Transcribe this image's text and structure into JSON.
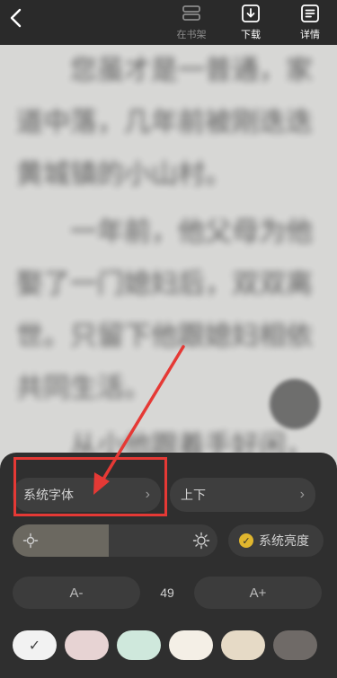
{
  "top_bar": {
    "actions": [
      {
        "label": "在书架",
        "icon": "bookshelf-icon"
      },
      {
        "label": "下载",
        "icon": "download-icon"
      },
      {
        "label": "详情",
        "icon": "details-icon"
      }
    ]
  },
  "reading": {
    "paragraphs": [
      "您虽才是一普通，家道中落，几年前被刚迭迭黄城镇的小山村。",
      "一年前，他父母为他娶了一门媳妇后，双双离世。只留下他跟媳妇相依共同生活。",
      "从小他跟着手好闲，么，在以前被嫁是一直最"
    ]
  },
  "panel": {
    "font_option": "系统字体",
    "flip_mode": "上下",
    "brightness": 0.47,
    "system_brightness": "系统亮度",
    "font_decrease": "A-",
    "font_size": "49",
    "font_increase": "A+",
    "themes": [
      {
        "color": "#f2f2f2",
        "selected": true
      },
      {
        "color": "#e7d3d3",
        "selected": false
      },
      {
        "color": "#cfe8dc",
        "selected": false
      },
      {
        "color": "#f4efe6",
        "selected": false
      },
      {
        "color": "#e6dac6",
        "selected": false
      },
      {
        "color": "#6f6a67",
        "selected": false
      }
    ]
  },
  "colors": {
    "highlight": "#e53935",
    "accent": "#e0b62e"
  }
}
